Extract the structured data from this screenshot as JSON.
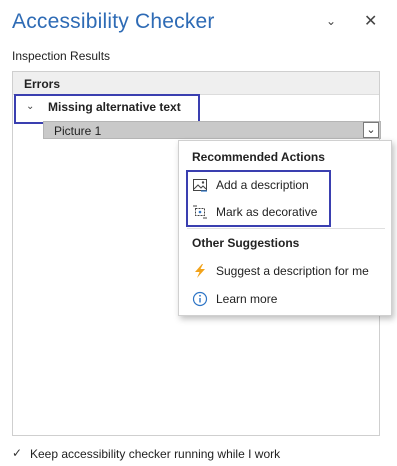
{
  "pane": {
    "title": "Accessibility Checker",
    "options_glyph": "⌄",
    "close_glyph": "✕"
  },
  "inspection": {
    "label": "Inspection Results"
  },
  "results": {
    "errors_label": "Errors",
    "issue": {
      "chevron": "⌄",
      "label": "Missing alternative text"
    },
    "item": {
      "label": "Picture 1",
      "dropdown_glyph": "⌄"
    }
  },
  "menu": {
    "recommended_heading": "Recommended Actions",
    "recommended_items": [
      {
        "label": "Add a description",
        "icon": "image-description-icon"
      },
      {
        "label": "Mark as decorative",
        "icon": "decorative-icon"
      }
    ],
    "other_heading": "Other Suggestions",
    "other_items": [
      {
        "label": "Suggest a description for me",
        "icon": "lightning-icon",
        "icon_color": "#f2a31b"
      },
      {
        "label": "Learn more",
        "icon": "info-icon",
        "icon_color": "#2e75c6"
      }
    ]
  },
  "footer": {
    "checkbox_glyph": "✓",
    "checked": true,
    "label": "Keep accessibility checker running while I work"
  },
  "colors": {
    "title": "#2e6bb5",
    "highlight": "#3a3fb0"
  }
}
